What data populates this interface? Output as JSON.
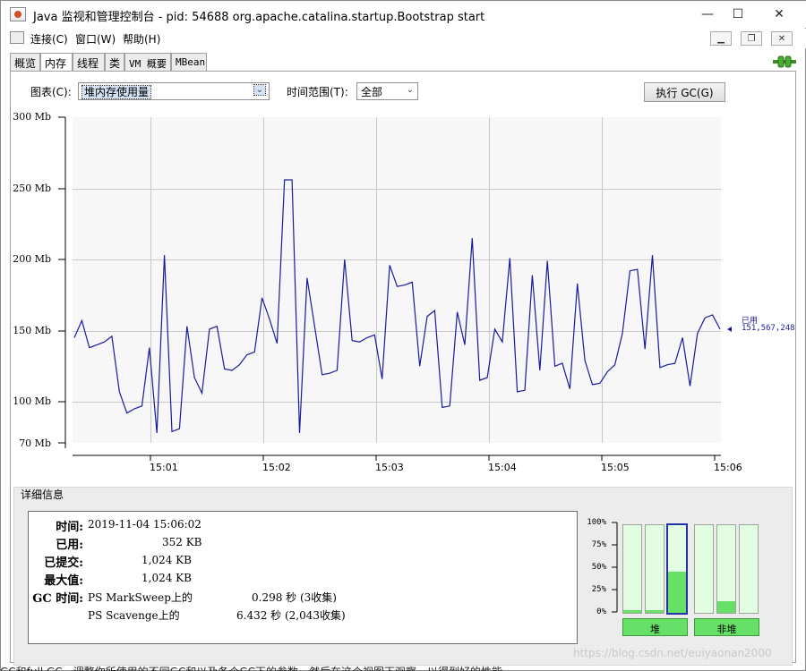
{
  "window": {
    "title": "Java 监视和管理控制台 - pid: 54688 org.apache.catalina.startup.Bootstrap start",
    "controls": {
      "minimize": "—",
      "maximize": "☐",
      "close": "✕"
    }
  },
  "menubar": {
    "items": [
      "连接(C)",
      "窗口(W)",
      "帮助(H)"
    ],
    "mdi": {
      "minimize": "▁",
      "restore": "❐",
      "close": "✕"
    }
  },
  "tabs": [
    {
      "label": "概览",
      "active": false
    },
    {
      "label": "内存",
      "active": true
    },
    {
      "label": "线程",
      "active": false
    },
    {
      "label": "类",
      "active": false
    },
    {
      "label": "VM 概要",
      "active": false
    },
    {
      "label": "MBean",
      "active": false
    }
  ],
  "connection_icon": "connection-plug-icon",
  "controls": {
    "chart_label": "图表(C):",
    "chart_value": "堆内存使用量",
    "range_label": "时间范围(T):",
    "range_value": "全部",
    "gc_button": "执行 GC(G)"
  },
  "chart_data": {
    "type": "line",
    "series": [
      {
        "name": "",
        "color": "#1a1aa0",
        "values": [
          145,
          157,
          138,
          140,
          142,
          146,
          107,
          92,
          95,
          97,
          138,
          78,
          203,
          79,
          81,
          153,
          117,
          106,
          151,
          153,
          123,
          122,
          126,
          133,
          135,
          173,
          158,
          141,
          256,
          256,
          78,
          187,
          153,
          119,
          120,
          122,
          200,
          143,
          142,
          145,
          147,
          116,
          196,
          181,
          182,
          184,
          125,
          160,
          164,
          96,
          97,
          163,
          140,
          215,
          115,
          117,
          151,
          142,
          201,
          107,
          108,
          189,
          122,
          199,
          125,
          127,
          109,
          183,
          129,
          112,
          113,
          121,
          126,
          148,
          192,
          193,
          137,
          203,
          124,
          126,
          127,
          145,
          111,
          148,
          159,
          161,
          151
        ]
      }
    ],
    "x_start": "15:00:16",
    "x_end": "15:06:02",
    "x_ticks": [
      "15:01",
      "15:02",
      "15:03",
      "15:04",
      "15:05",
      "15:06"
    ],
    "y_ticks": [
      "300 Mb",
      "250 Mb",
      "200 Mb",
      "150 Mb",
      "100 Mb",
      "70 Mb"
    ],
    "ylim": [
      70,
      300
    ],
    "ylabel": "",
    "xlabel": "",
    "grid": true,
    "end_label_title": "已用",
    "end_label_value": "151,567,248"
  },
  "details": {
    "section_title": "详细信息",
    "rows": [
      {
        "key": "时间:",
        "value": "2019-11-04 15:06:02"
      },
      {
        "key": "已用:",
        "value": "352 KB"
      },
      {
        "key": "已提交:",
        "value": "1,024 KB"
      },
      {
        "key": "最大值:",
        "value": "1,024 KB"
      }
    ],
    "gc_key": "GC 时间:",
    "gc_rows": [
      {
        "collector": "PS MarkSweep上的",
        "value": "0.298 秒 (3收集)"
      },
      {
        "collector": "PS Scavenge上的",
        "value": "6.432 秒 (2,043收集)"
      }
    ]
  },
  "pool_chart": {
    "pct_labels": [
      "100%",
      "75%",
      "50%",
      "25%",
      "0%"
    ],
    "heap_fills": [
      0.03,
      0.03,
      0.47
    ],
    "nonheap_fills": [
      0.0,
      0.13,
      0.0
    ],
    "heap_label": "堆",
    "nonheap_label": "非堆"
  },
  "watermark": "https://blog.csdn.net/euiyaonan2000",
  "background_text": "GC和full GC，调整你所使用的不同GC和以及各个GC下的参数，然后在这个视图下观察，以得到好的性能。"
}
